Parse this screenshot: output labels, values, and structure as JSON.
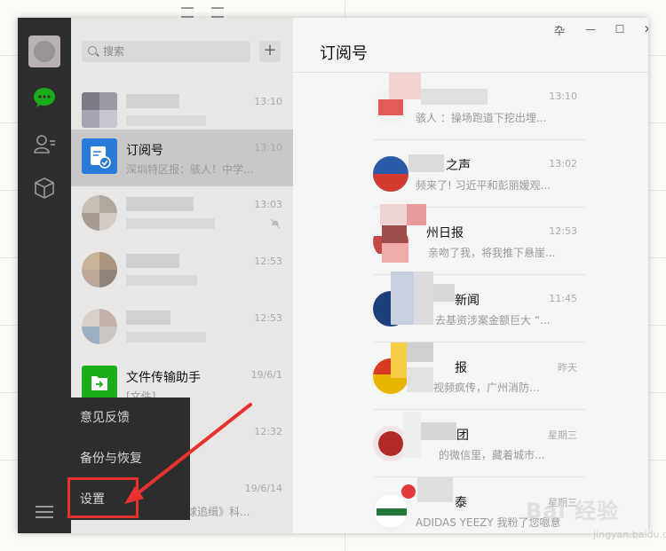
{
  "search": {
    "placeholder": "搜索"
  },
  "header": {
    "add_label": "+"
  },
  "chat_list": [
    {
      "title": "",
      "subtitle": "",
      "time": "13:10"
    },
    {
      "title": "订阅号",
      "subtitle": "深圳特区报：骇人！中学...",
      "time": "13:10"
    },
    {
      "title": "",
      "subtitle": "",
      "time": "13:03"
    },
    {
      "title": "",
      "subtitle": "",
      "time": "12:53"
    },
    {
      "title": "",
      "subtitle": "",
      "time": "12:53"
    },
    {
      "title": "文件传输助手",
      "subtitle": "[文件]",
      "time": "19/6/1"
    },
    {
      "title": "",
      "subtitle": "",
      "time": "12:32"
    },
    {
      "title": "",
      "subtitle": "球追缉》科...",
      "time": "19/6/14"
    }
  ],
  "popup_menu": [
    {
      "label": "意见反馈"
    },
    {
      "label": "备份与恢复"
    },
    {
      "label": "设置"
    }
  ],
  "pane": {
    "title": "订阅号"
  },
  "window_controls": {
    "pin": "卆",
    "minimize": "—",
    "maximize": "☐",
    "close": "✕"
  },
  "subscriptions": [
    {
      "title": "",
      "subtitle": "骇人  ：操场跑道下挖出埋...",
      "time": "13:10"
    },
    {
      "title": "之声",
      "subtitle": "频来了! 习近平和彭丽媛观...",
      "time": "13:02"
    },
    {
      "title": "州日报",
      "subtitle": "亲吻了我，将我推下悬崖...",
      "time": "12:53"
    },
    {
      "title": "新闻",
      "subtitle": "去基资涉案金额巨大 “...",
      "time": "11:45"
    },
    {
      "title": "报",
      "subtitle": "视频疯传，广州消防...",
      "time": "昨天"
    },
    {
      "title": "团",
      "subtitle": "的微信里，藏着城市...",
      "time": "星期三"
    },
    {
      "title": "泰",
      "subtitle": "ADIDAS YEEZY  我粉了您嗯意",
      "time": "星期三"
    }
  ],
  "watermark": {
    "main": "Bai 经验",
    "sub": "jingyan.baidu.com"
  },
  "colors": {
    "nav_bg": "#2e2e2e",
    "list_bg": "#e8e7e6",
    "selected_bg": "#c9c8c6",
    "accent_green": "#1aad19",
    "annotation_red": "#e8322e"
  }
}
